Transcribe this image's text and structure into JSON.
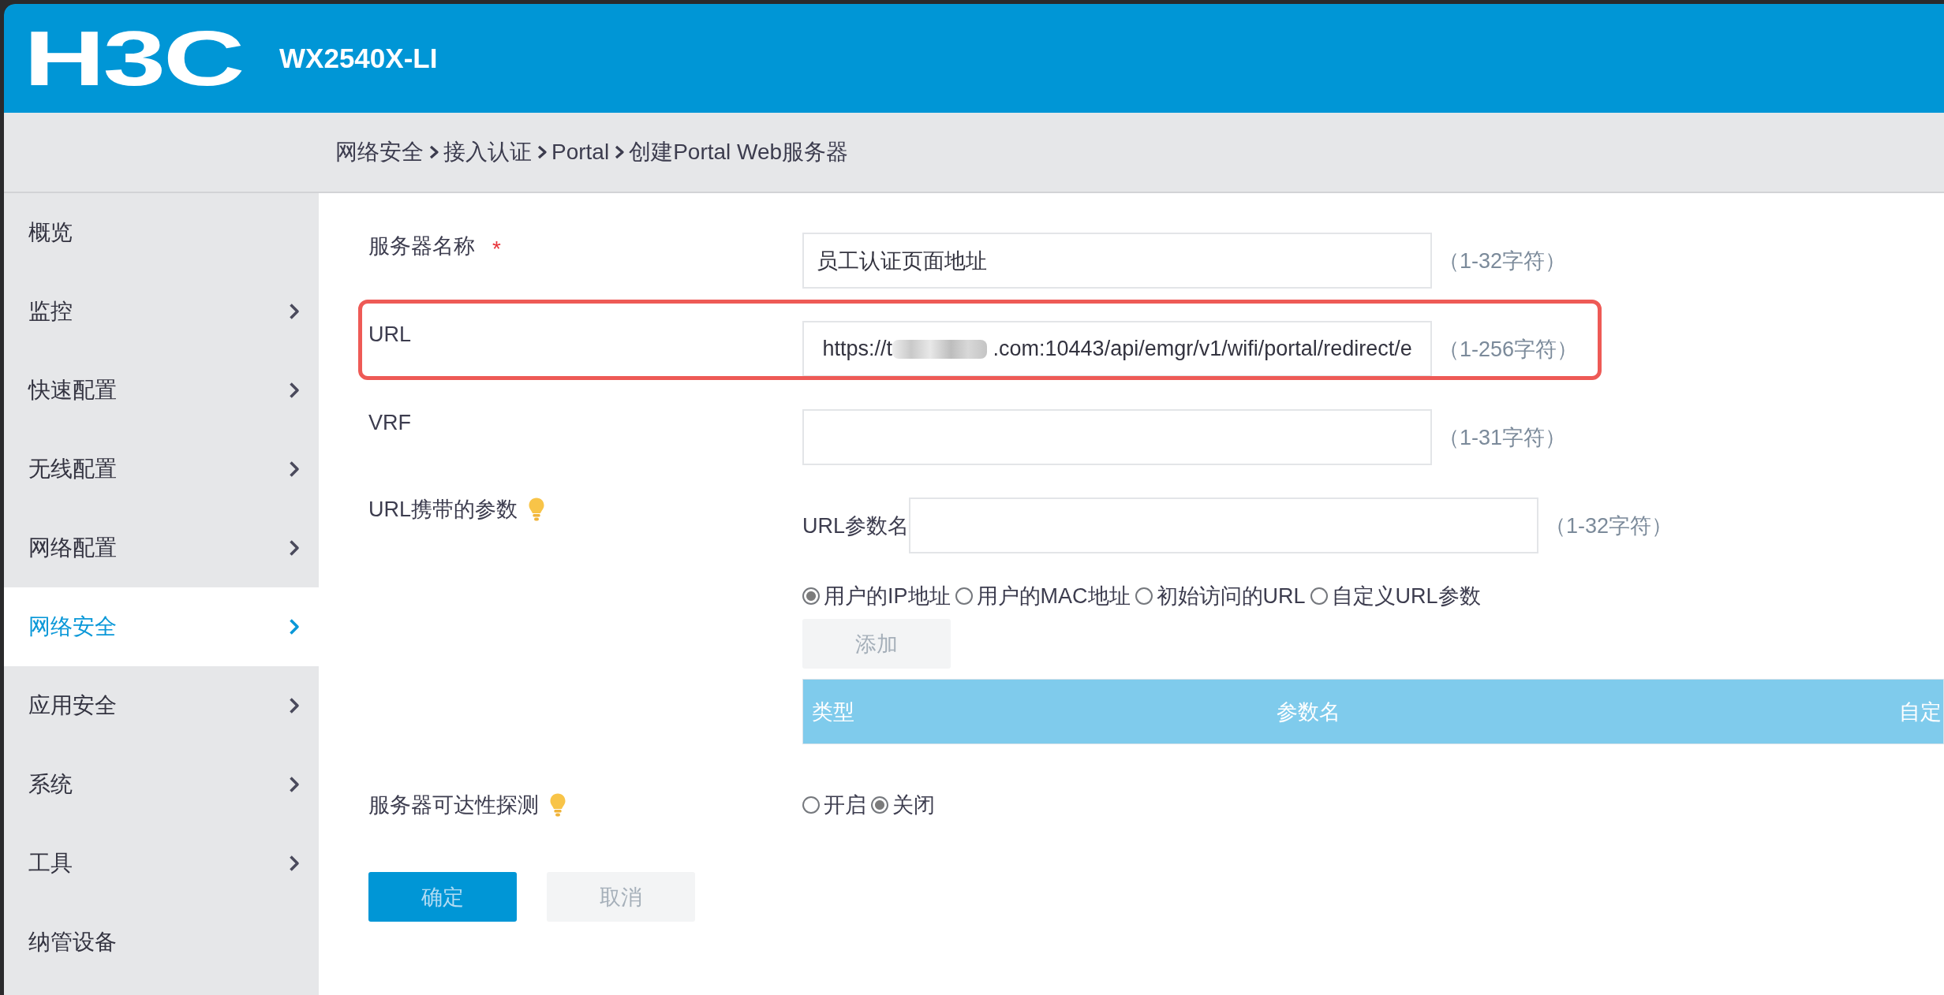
{
  "header": {
    "logo": "H3C",
    "model": "WX2540X-LI"
  },
  "breadcrumb": [
    "网络安全",
    "接入认证",
    "Portal",
    "创建Portal Web服务器"
  ],
  "sidebar": {
    "items": [
      {
        "label": "概览",
        "selected": false,
        "has_submenu": false
      },
      {
        "label": "监控",
        "selected": false,
        "has_submenu": true
      },
      {
        "label": "快速配置",
        "selected": false,
        "has_submenu": true
      },
      {
        "label": "无线配置",
        "selected": false,
        "has_submenu": true
      },
      {
        "label": "网络配置",
        "selected": false,
        "has_submenu": true
      },
      {
        "label": "网络安全",
        "selected": true,
        "has_submenu": true
      },
      {
        "label": "应用安全",
        "selected": false,
        "has_submenu": true
      },
      {
        "label": "系统",
        "selected": false,
        "has_submenu": true
      },
      {
        "label": "工具",
        "selected": false,
        "has_submenu": true
      },
      {
        "label": "纳管设备",
        "selected": false,
        "has_submenu": false
      }
    ]
  },
  "form": {
    "fields": [
      {
        "kind": "text",
        "label": "服务器名称",
        "required_mark": "*",
        "value": "员工认证页面地址",
        "hint": "（1-32字符）"
      },
      {
        "kind": "text",
        "label": "URL",
        "value_parts": [
          "https://t",
          ".com:10443/api/emgr/v1/wifi/portal/redirect/e"
        ],
        "redacted": true,
        "hint": "（1-256字符）",
        "highlighted": true
      },
      {
        "kind": "text",
        "label": "VRF",
        "hint": "（1-31字符）"
      },
      {
        "kind": "params",
        "label": "URL携带的参数",
        "tip_icon": true,
        "name_label": "URL参数名",
        "hint": "（1-32字符）",
        "options": [
          {
            "label": "用户的IP地址",
            "selected": true
          },
          {
            "label": "用户的MAC地址",
            "selected": false
          },
          {
            "label": "初始访问的URL",
            "selected": false
          },
          {
            "label": "自定义URL参数",
            "selected": false
          }
        ],
        "add_button": "添加",
        "table": {
          "columns": [
            "类型",
            "参数名",
            "自定"
          ]
        }
      },
      {
        "kind": "radio",
        "label": "服务器可达性探测",
        "tip_icon": true,
        "options": [
          {
            "label": "开启",
            "selected": false
          },
          {
            "label": "关闭",
            "selected": true
          }
        ]
      }
    ]
  },
  "buttons": [
    {
      "label": "确定",
      "kind": "primary"
    },
    {
      "label": "取消",
      "kind": "secondary"
    }
  ]
}
